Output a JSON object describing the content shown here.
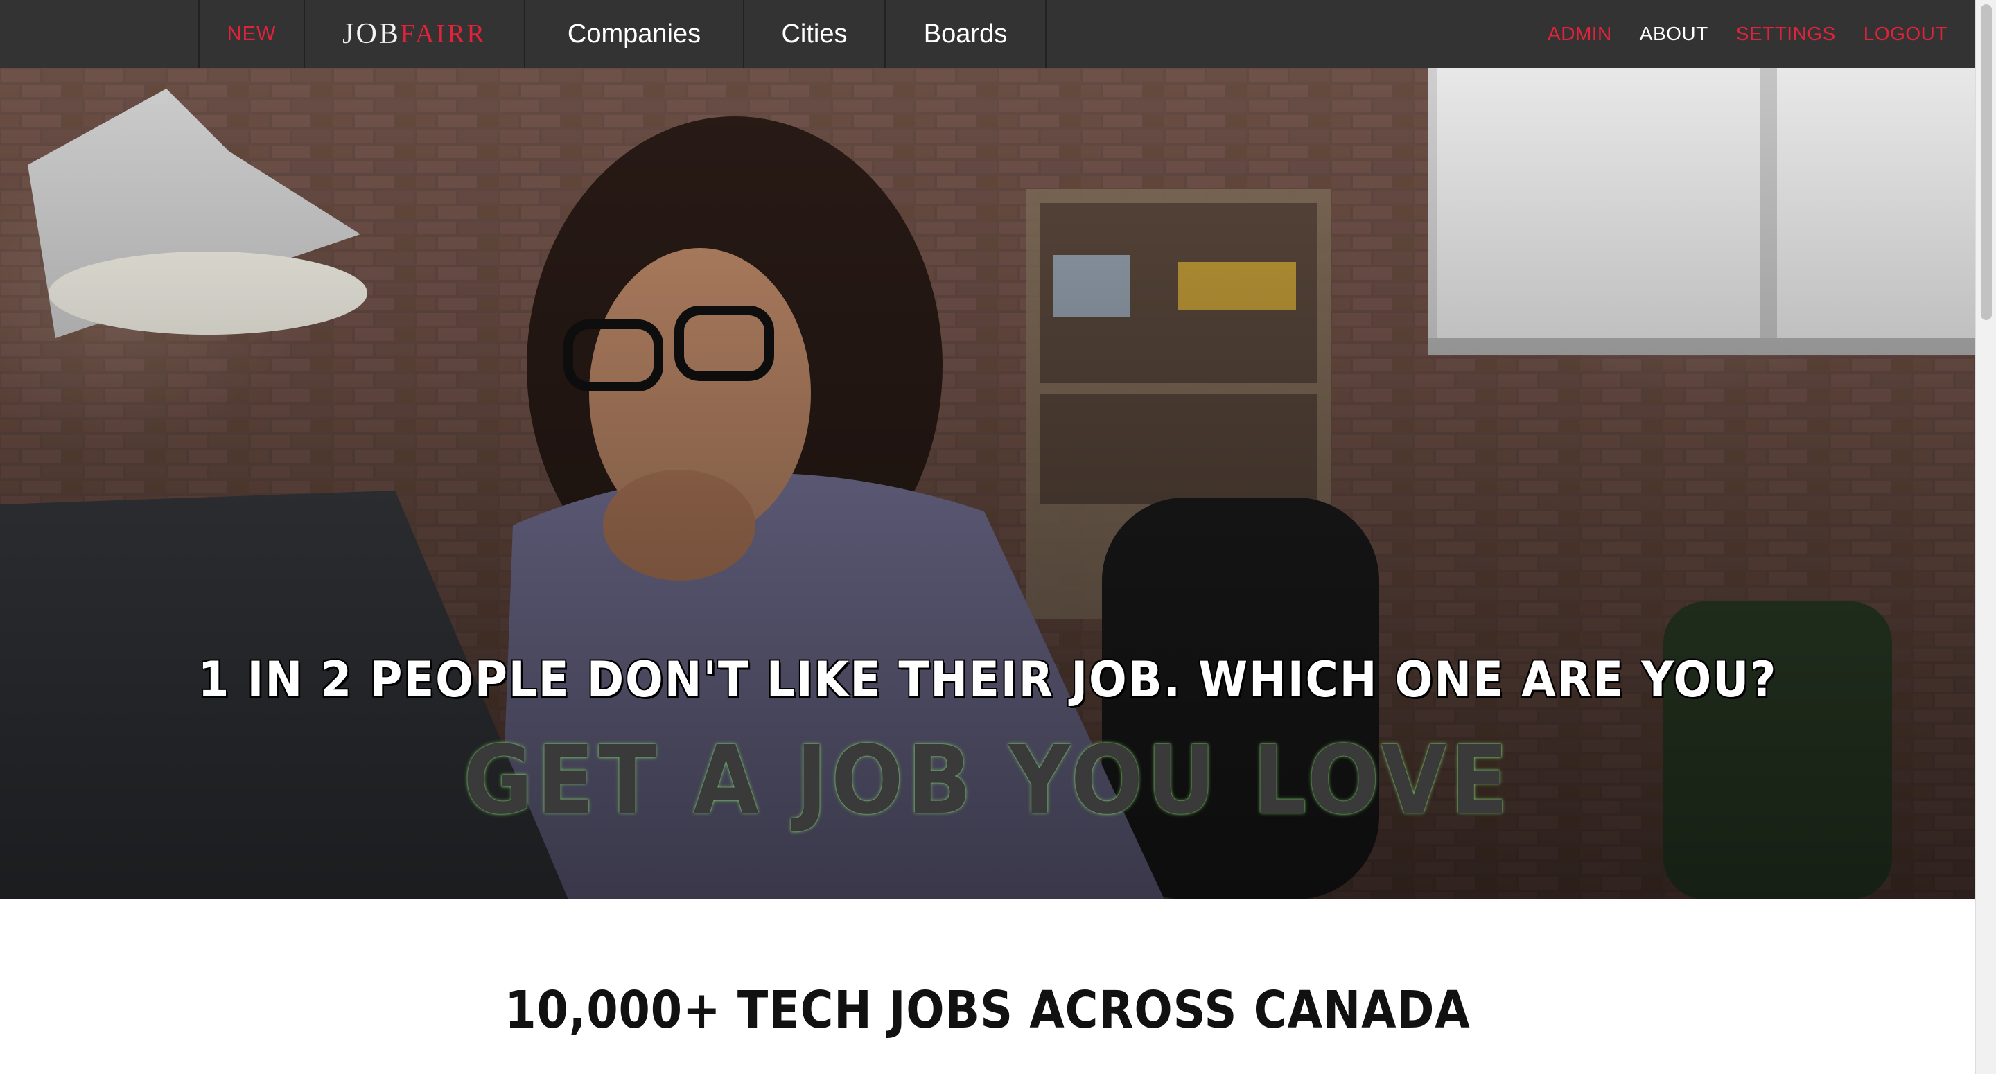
{
  "nav": {
    "new_label": "NEW",
    "logo_job": "JOB",
    "logo_fairr": "FAIRR",
    "links": [
      "Companies",
      "Cities",
      "Boards"
    ],
    "right": {
      "admin": "ADMIN",
      "about": "ABOUT",
      "settings": "SETTINGS",
      "logout": "LOGOUT"
    }
  },
  "hero": {
    "tagline": "1 IN 2 PEOPLE DON'T LIKE THEIR JOB. WHICH ONE ARE YOU?",
    "headline": "GET A JOB YOU LOVE",
    "image_icon": "hero-photo-woman-at-laptop"
  },
  "section": {
    "title": "10,000+ TECH JOBS ACROSS CANADA"
  },
  "colors": {
    "nav_bg": "#333333",
    "accent_red": "#e0233a",
    "headline_glow": "#7bd36a"
  }
}
